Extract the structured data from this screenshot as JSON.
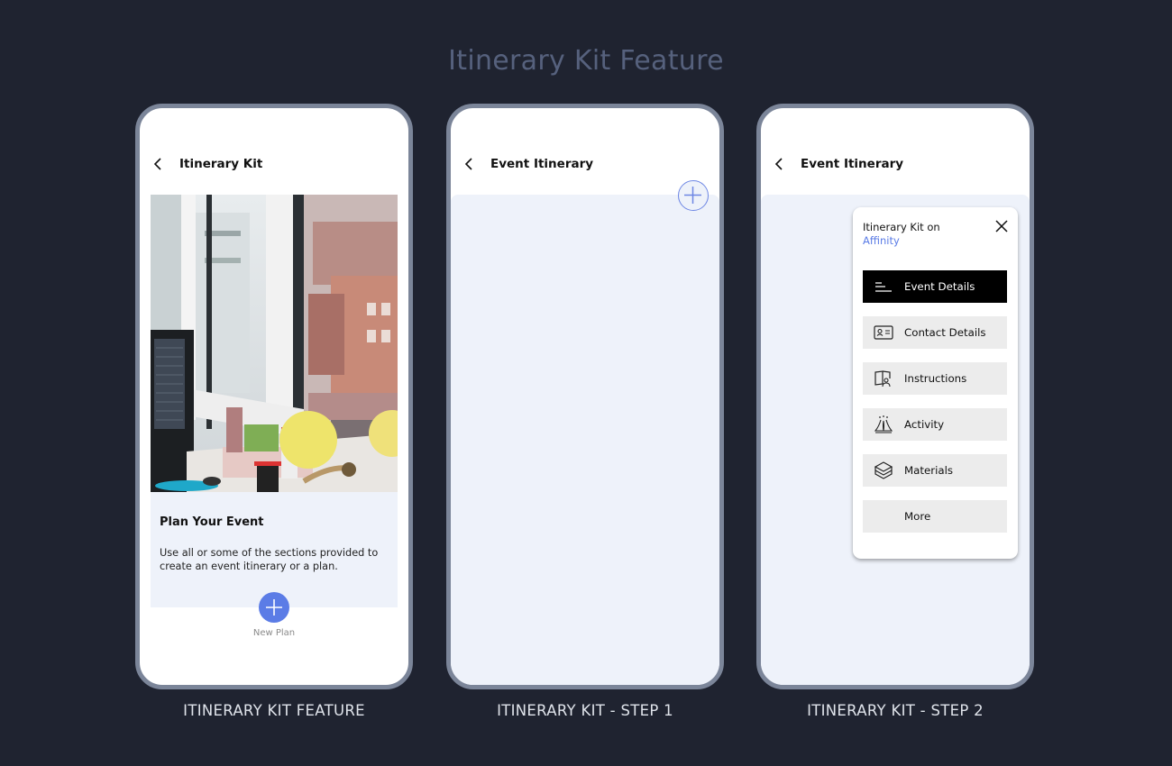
{
  "page": {
    "title": "Itinerary Kit Feature"
  },
  "screens": [
    {
      "caption": "ITINERARY KIT FEATURE",
      "header_title": "Itinerary Kit",
      "card_title": "Plan Your Event",
      "card_description": "Use all or some of the sections provided to create an event itinerary or a plan.",
      "new_plan_label": "New Plan",
      "hero_image": "office-desk-window-photo"
    },
    {
      "caption": "ITINERARY KIT - STEP 1",
      "header_title": "Event Itinerary"
    },
    {
      "caption": "ITINERARY KIT - STEP 2",
      "header_title": "Event Itinerary",
      "popup": {
        "title": "Itinerary Kit on",
        "brand": "Affinity",
        "items": [
          {
            "label": "Event Details",
            "icon": "lines-icon",
            "active": true
          },
          {
            "label": "Contact Details",
            "icon": "contact-card-icon",
            "active": false
          },
          {
            "label": "Instructions",
            "icon": "book-icon",
            "active": false
          },
          {
            "label": "Activity",
            "icon": "people-activity-icon",
            "active": false
          },
          {
            "label": "Materials",
            "icon": "layers-icon",
            "active": false
          },
          {
            "label": "More",
            "icon": "",
            "active": false
          }
        ]
      }
    }
  ],
  "colors": {
    "background": "#1f2330",
    "accent": "#5b7ce6",
    "panel": "#eef2fa",
    "phone_frame": "#7b8599"
  }
}
